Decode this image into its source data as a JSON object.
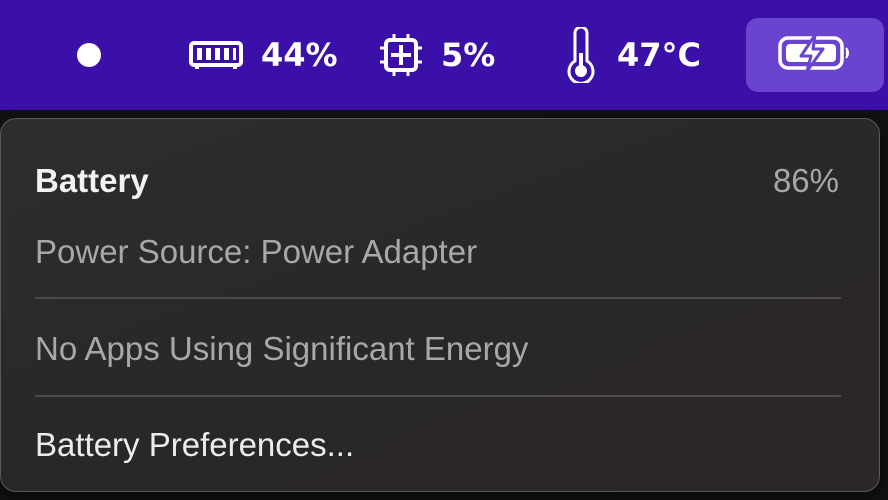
{
  "menubar": {
    "memory": {
      "icon": "memory-chip-icon",
      "value": "44%"
    },
    "cpu": {
      "icon": "cpu-icon",
      "value": "5%"
    },
    "temperature": {
      "icon": "thermometer-icon",
      "value": "47°C"
    },
    "battery_icon": "battery-charging-icon",
    "colors": {
      "bar": "#3a10a8",
      "active_button": "#6a44cf"
    }
  },
  "battery_menu": {
    "title": "Battery",
    "percent": "86%",
    "power_source": "Power Source: Power Adapter",
    "energy_status": "No Apps Using Significant Energy",
    "preferences_label": "Battery Preferences..."
  }
}
